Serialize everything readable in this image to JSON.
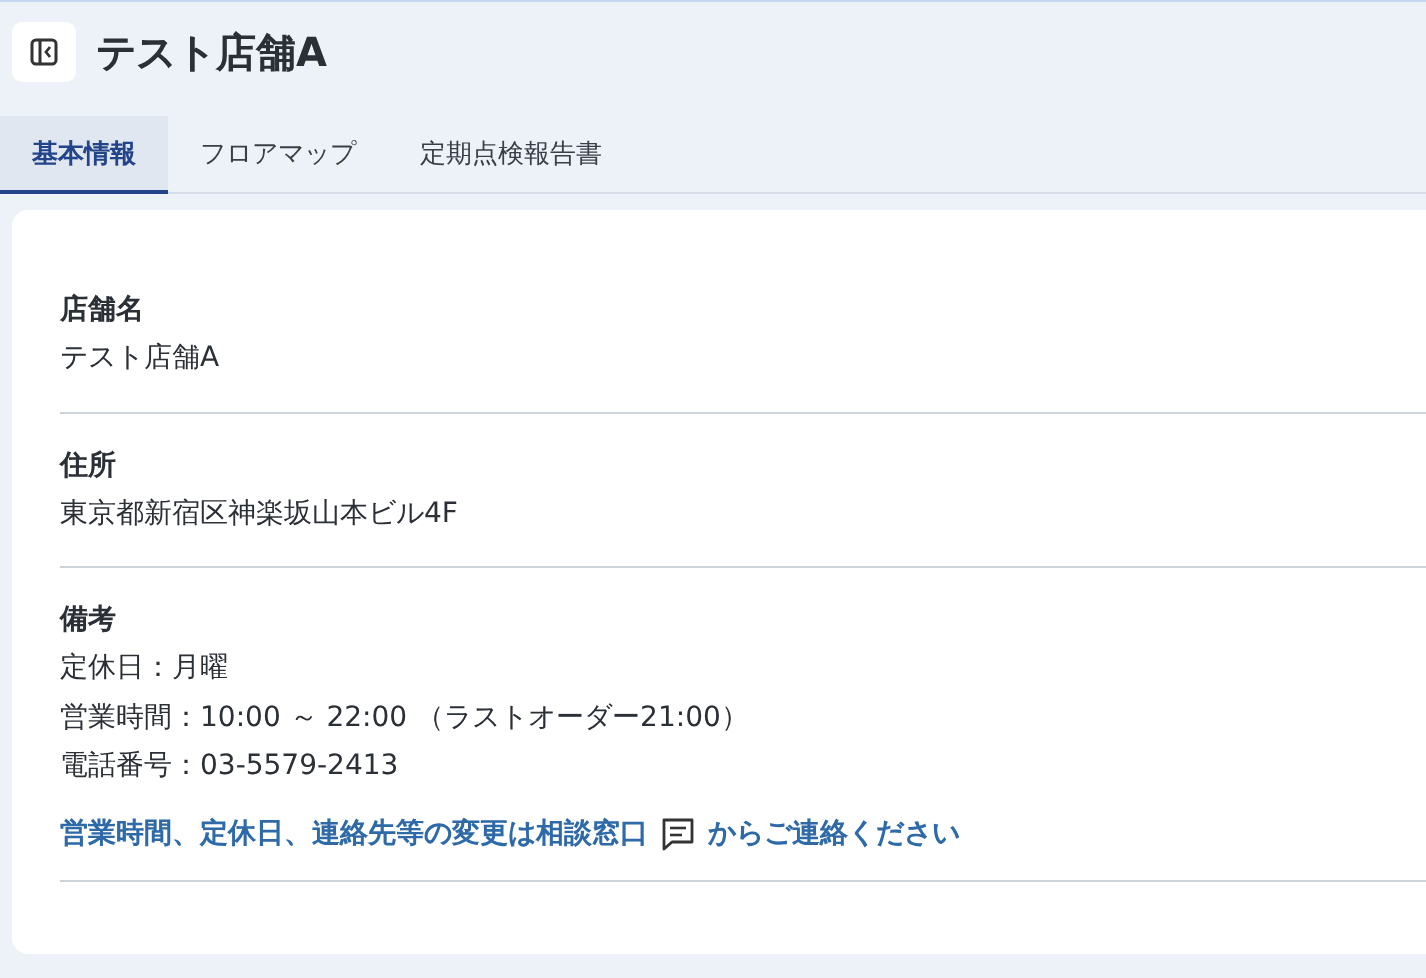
{
  "header": {
    "title": "テスト店舗A"
  },
  "tabs": [
    {
      "label": "基本情報",
      "selected": true
    },
    {
      "label": "フロアマップ",
      "selected": false
    },
    {
      "label": "定期点検報告書",
      "selected": false
    }
  ],
  "fields": [
    {
      "label": "店舗名",
      "lines": [
        "テスト店舗A"
      ]
    },
    {
      "label": "住所",
      "lines": [
        "東京都新宿区神楽坂山本ビル4F"
      ]
    },
    {
      "label": "備考",
      "lines": [
        "定休日：月曜",
        "営業時間：10:00 ～ 22:00 （ラストオーダー21:00）",
        "電話番号：03-5579-2413"
      ],
      "note": {
        "before": "営業時間、定休日、連絡先等の変更は相談窓口",
        "after": "からご連絡ください"
      }
    }
  ]
}
